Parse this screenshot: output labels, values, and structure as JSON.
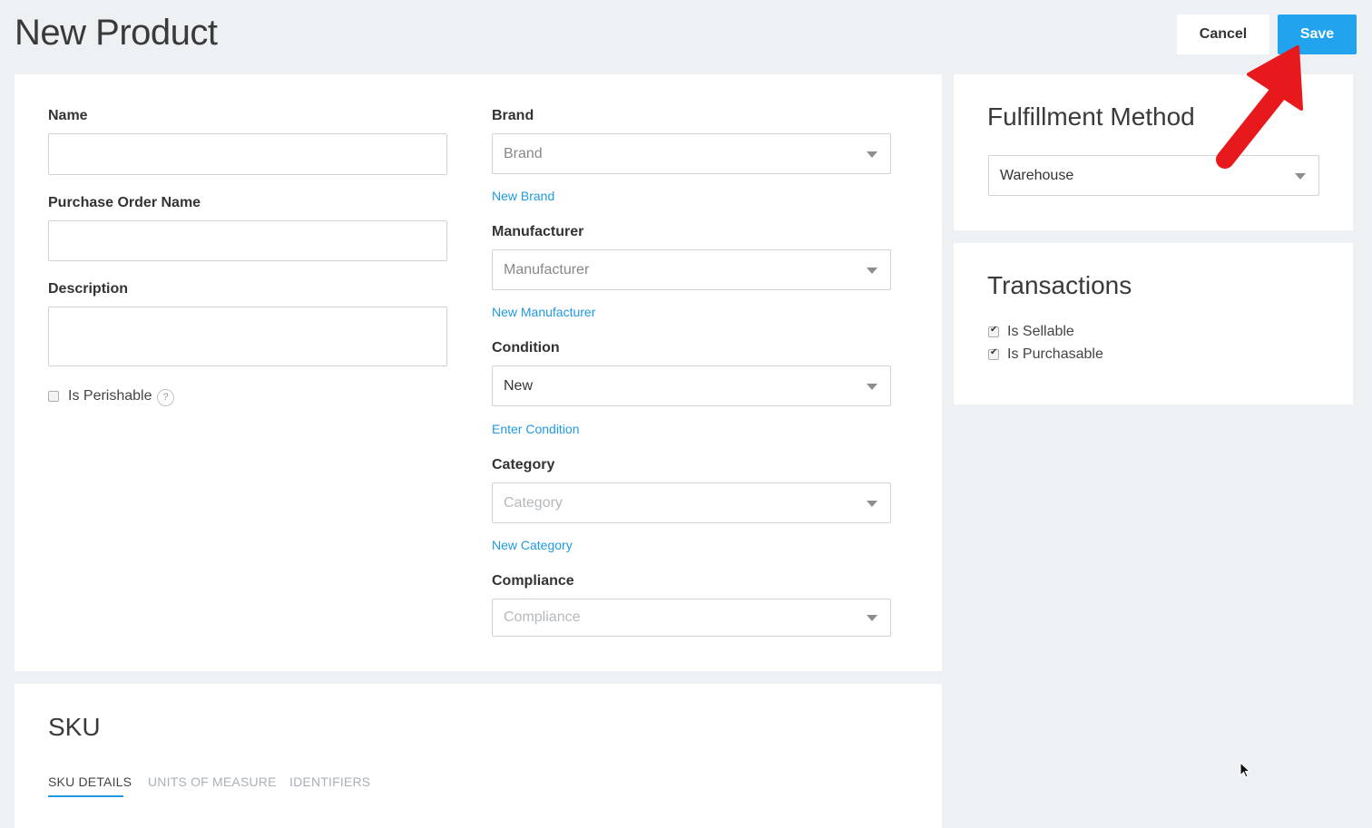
{
  "header": {
    "title": "New Product",
    "cancel_label": "Cancel",
    "save_label": "Save"
  },
  "main_form": {
    "name_label": "Name",
    "name_value": "",
    "po_name_label": "Purchase Order Name",
    "po_name_value": "",
    "description_label": "Description",
    "description_value": "",
    "perishable_label": "Is Perishable",
    "perishable_checked": false,
    "help_glyph": "?",
    "brand_label": "Brand",
    "brand_placeholder": "Brand",
    "new_brand_link": "New Brand",
    "manufacturer_label": "Manufacturer",
    "manufacturer_placeholder": "Manufacturer",
    "new_manufacturer_link": "New Manufacturer",
    "condition_label": "Condition",
    "condition_value": "New",
    "enter_condition_link": "Enter Condition",
    "category_label": "Category",
    "category_placeholder": "Category",
    "new_category_link": "New Category",
    "compliance_label": "Compliance",
    "compliance_placeholder": "Compliance"
  },
  "fulfillment": {
    "title": "Fulfillment Method",
    "value": "Warehouse"
  },
  "transactions": {
    "title": "Transactions",
    "items": [
      {
        "label": "Is Sellable",
        "checked": true
      },
      {
        "label": "Is Purchasable",
        "checked": true
      }
    ]
  },
  "sku": {
    "title": "SKU",
    "tabs": [
      {
        "label": "SKU Details",
        "active": true
      },
      {
        "label": "Units of Measure",
        "active": false
      },
      {
        "label": "Identifiers",
        "active": false
      }
    ]
  },
  "colors": {
    "accent": "#22a3ee",
    "link": "#1f9ae0",
    "annotation_arrow": "#e8191c",
    "background": "#eef1f4"
  },
  "icons": {
    "annotation": "red-arrow-icon",
    "dropdown": "caret-down-icon",
    "help": "help-circle-icon",
    "cursor": "mouse-cursor-icon"
  }
}
